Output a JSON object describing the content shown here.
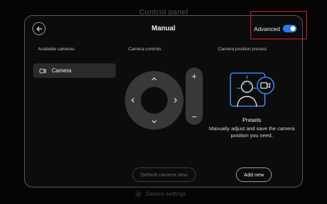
{
  "background": {
    "title": "Control panel",
    "device_settings_label": "Device settings",
    "icons": {
      "device_settings": "gear-icon"
    }
  },
  "header": {
    "title": "Manual",
    "advanced_label": "Advanced",
    "advanced_enabled": true,
    "icons": {
      "back": "arrow-left-icon"
    }
  },
  "sections": {
    "available_cameras": "Available cameras",
    "camera_controls": "Camera controls",
    "presets": "Camera position presets"
  },
  "cameras": [
    {
      "label": "Camera",
      "icon": "camera-icon",
      "selected": true
    }
  ],
  "controls": {
    "zoom_in": "+",
    "zoom_out": "−",
    "icons": [
      "chevron-up-icon",
      "chevron-down-icon",
      "chevron-left-icon",
      "chevron-right-icon"
    ]
  },
  "presets": {
    "title": "Presets",
    "description": "Manually adjust and save the camera position you need.",
    "icon": "person-camera-illustration"
  },
  "buttons": {
    "default_view": "Default camera view",
    "add_new": "Add new"
  },
  "colors": {
    "accent": "#2c7be5",
    "highlight_box": "#e0202a",
    "panel": "#0c0c0c",
    "control": "#383838"
  }
}
